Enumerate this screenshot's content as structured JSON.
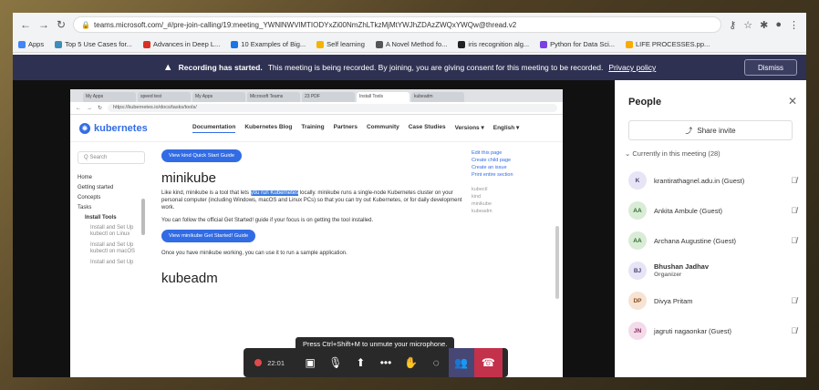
{
  "browser": {
    "url": "teams.microsoft.com/_#/pre-join-calling/19:meeting_YWNlNWVlMTIODYxZi00NmZhLTkzMjMtYWJhZDAzZWQxYWQw@thread.v2",
    "bookmarks": [
      {
        "label": "Apps",
        "color": "#4285f4"
      },
      {
        "label": "Top 5 Use Cases for...",
        "color": "#3c8dbc"
      },
      {
        "label": "Advances in Deep L...",
        "color": "#d93025"
      },
      {
        "label": "10 Examples of Big...",
        "color": "#1a73e8"
      },
      {
        "label": "Self learning",
        "color": "#f4b400"
      },
      {
        "label": "A Novel Method fo...",
        "color": "#555555"
      },
      {
        "label": "iris recognition alg...",
        "color": "#222222"
      },
      {
        "label": "Python for Data Sci...",
        "color": "#7b3fe4"
      },
      {
        "label": "LIFE PROCESSES.pp...",
        "color": "#f9ab00"
      }
    ]
  },
  "banner": {
    "title": "Recording has started.",
    "message": "This meeting is being recorded. By joining, you are giving consent for this meeting to be recorded.",
    "link": "Privacy policy",
    "dismiss": "Dismiss"
  },
  "shared_screen": {
    "tabs": [
      "My Apps",
      "speed test",
      "My Apps",
      "Microsoft Teams",
      "23 PDF",
      "Install Tools",
      "kubeadm"
    ],
    "url": "https://kubernetes.io/docs/tasks/tools/",
    "logo": "kubernetes",
    "nav": [
      "Documentation",
      "Kubernetes Blog",
      "Training",
      "Partners",
      "Community",
      "Case Studies",
      "Versions ▾",
      "English ▾"
    ],
    "search": "Q Search",
    "sidebar": [
      "Home",
      "Getting started",
      "Concepts",
      "Tasks"
    ],
    "sidebar_bold": "Install Tools",
    "sidebar_subs": [
      "Install and Set Up kubectl on Linux",
      "Install and Set Up kubectl on macOS",
      "Install and Set Up"
    ],
    "kind_button": "View kind Quick Start Guide",
    "heading1": "minikube",
    "para1_a": "Like kind, minikube is a tool that lets",
    "para1_hl": "you run Kubernetes",
    "para1_b": "locally. minikube runs a single-node Kubernetes cluster on your personal computer (including Windows, macOS and Linux PCs) so that you can try out Kubernetes, or for daily development work.",
    "para2": "You can follow the official Get Started! guide if your focus is on getting the tool installed.",
    "minikube_button": "View minikube Get Started! Guide",
    "para3": "Once you have minikube working, you can use it to run a sample application.",
    "heading2": "kubeadm",
    "right_links": [
      "Edit this page",
      "Create child page",
      "Create an issue",
      "Print entire section"
    ],
    "right_toc": [
      "kubectl",
      "kind",
      "minikube",
      "kubeadm"
    ]
  },
  "toast": "Press Ctrl+Shift+M to unmute your microphone.",
  "call": {
    "timer": "22:01",
    "record_color": "#e04a4a",
    "hangup_color": "#c4314b"
  },
  "panel": {
    "title": "People",
    "share_invite": "Share invite",
    "section": "Currently in this meeting (28)",
    "people": [
      {
        "initials": "K",
        "name": "krantirathagnel.adu.in (Guest)",
        "role": "",
        "bg": "#e6e4f5",
        "fg": "#464775"
      },
      {
        "initials": "AA",
        "name": "Ankita Ambule (Guest)",
        "role": "",
        "bg": "#d9ecd6",
        "fg": "#2d6a2d"
      },
      {
        "initials": "AA",
        "name": "Archana Augustine (Guest)",
        "role": "",
        "bg": "#d9ecd6",
        "fg": "#2d6a2d"
      },
      {
        "initials": "BJ",
        "name": "Bhushan Jadhav",
        "role": "Organizer",
        "bg": "#e6e4f5",
        "fg": "#464775"
      },
      {
        "initials": "DP",
        "name": "Divya Pritam",
        "role": "",
        "bg": "#f7e3d3",
        "fg": "#8a4b1d"
      },
      {
        "initials": "JN",
        "name": "jagruti nagaonkar (Guest)",
        "role": "",
        "bg": "#f3dbe9",
        "fg": "#8a2a5e"
      }
    ]
  }
}
